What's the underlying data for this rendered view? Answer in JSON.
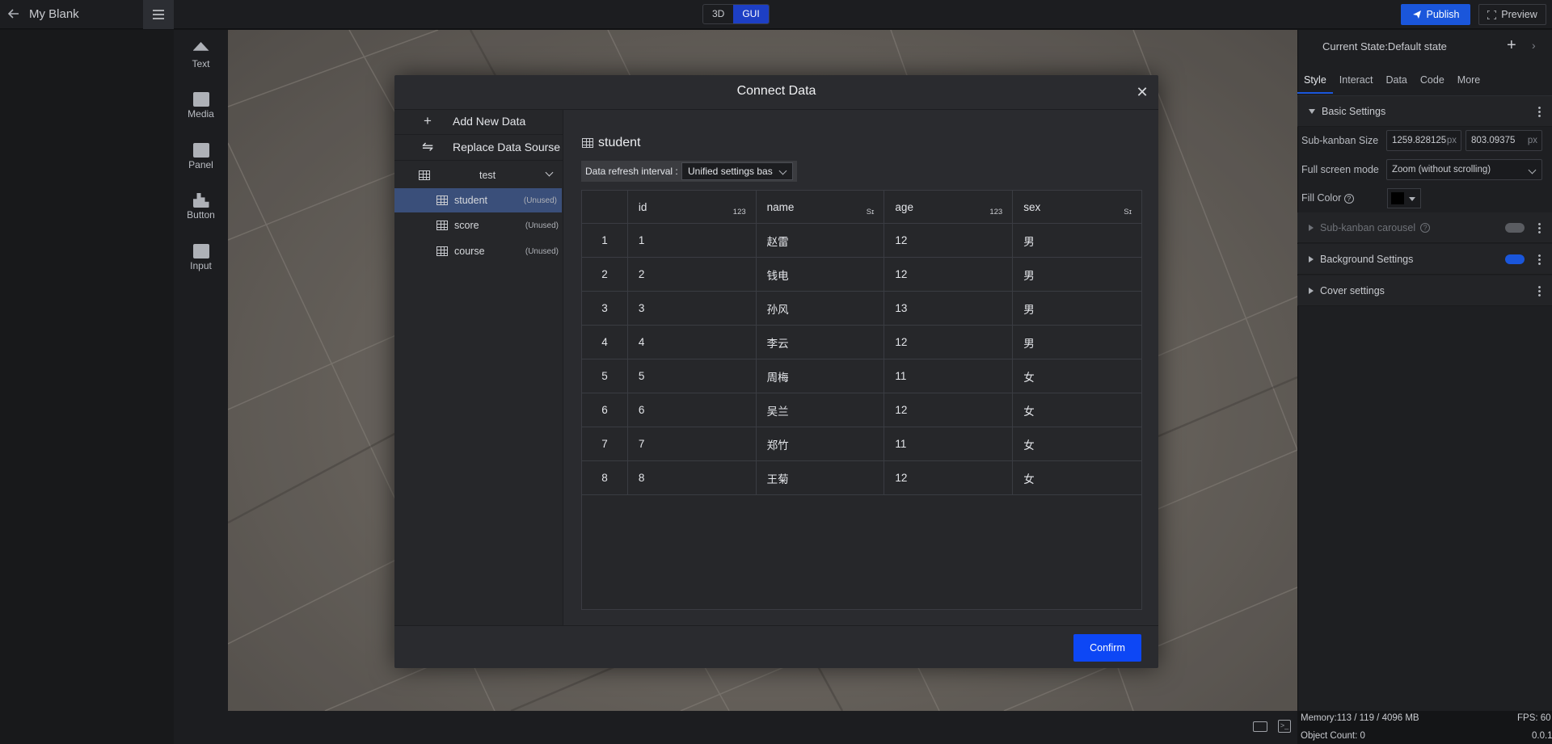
{
  "app": {
    "project_title": "My Blank",
    "mode_3d": "3D",
    "mode_gui": "GUI",
    "publish": "Publish",
    "preview": "Preview"
  },
  "toolbar": {
    "items": [
      {
        "label": "Text",
        "icon": "text-icon"
      },
      {
        "label": "Media",
        "icon": "media-icon"
      },
      {
        "label": "Panel",
        "icon": "panel-icon"
      },
      {
        "label": "Button",
        "icon": "button-icon"
      },
      {
        "label": "Input",
        "icon": "input-icon"
      }
    ]
  },
  "right_panel": {
    "title": "Current State:Default state",
    "tabs": [
      "Style",
      "Interact",
      "Data",
      "Code",
      "More"
    ],
    "active_tab": "Style",
    "basic_settings": "Basic Settings",
    "sub_kanban_size_label": "Sub-kanban Size",
    "width_value": "1259.828125",
    "height_value": "803.09375",
    "unit": "px",
    "full_screen_label": "Full screen mode",
    "full_screen_value": "Zoom (without scrolling)",
    "fill_color_label": "Fill Color",
    "fill_color": "#000000",
    "carousel": "Sub-kanban carousel",
    "background_settings": "Background Settings",
    "cover_settings": "Cover settings"
  },
  "status": {
    "memory": "Memory:113 / 119 / 4096 MB",
    "fps": "FPS: 60",
    "object_count": "Object Count: 0",
    "version": "0.0.1"
  },
  "modal": {
    "title": "Connect Data",
    "add_new": "Add New Data",
    "replace": "Replace Data Sourse",
    "group": "test",
    "tables": [
      {
        "name": "student",
        "status": "(Unused)"
      },
      {
        "name": "score",
        "status": "(Unused)"
      },
      {
        "name": "course",
        "status": "(Unused)"
      }
    ],
    "selected_table": "student",
    "refresh_label": "Data refresh interval :",
    "refresh_value": "Unified settings bas",
    "confirm": "Confirm"
  },
  "table_data": {
    "columns": [
      {
        "name": "id",
        "type": "123"
      },
      {
        "name": "name",
        "type": "Sɪ"
      },
      {
        "name": "age",
        "type": "123"
      },
      {
        "name": "sex",
        "type": "Sɪ"
      }
    ],
    "rows": [
      [
        "1",
        "1",
        "赵雷",
        "12",
        "男"
      ],
      [
        "2",
        "2",
        "钱电",
        "12",
        "男"
      ],
      [
        "3",
        "3",
        "孙风",
        "13",
        "男"
      ],
      [
        "4",
        "4",
        "李云",
        "12",
        "男"
      ],
      [
        "5",
        "5",
        "周梅",
        "11",
        "女"
      ],
      [
        "6",
        "6",
        "吴兰",
        "12",
        "女"
      ],
      [
        "7",
        "7",
        "郑竹",
        "11",
        "女"
      ],
      [
        "8",
        "8",
        "王菊",
        "12",
        "女"
      ]
    ]
  },
  "colors": {
    "accent": "#1a56db",
    "confirm": "#0d47f5",
    "selected_row": "#3a4f7a"
  }
}
